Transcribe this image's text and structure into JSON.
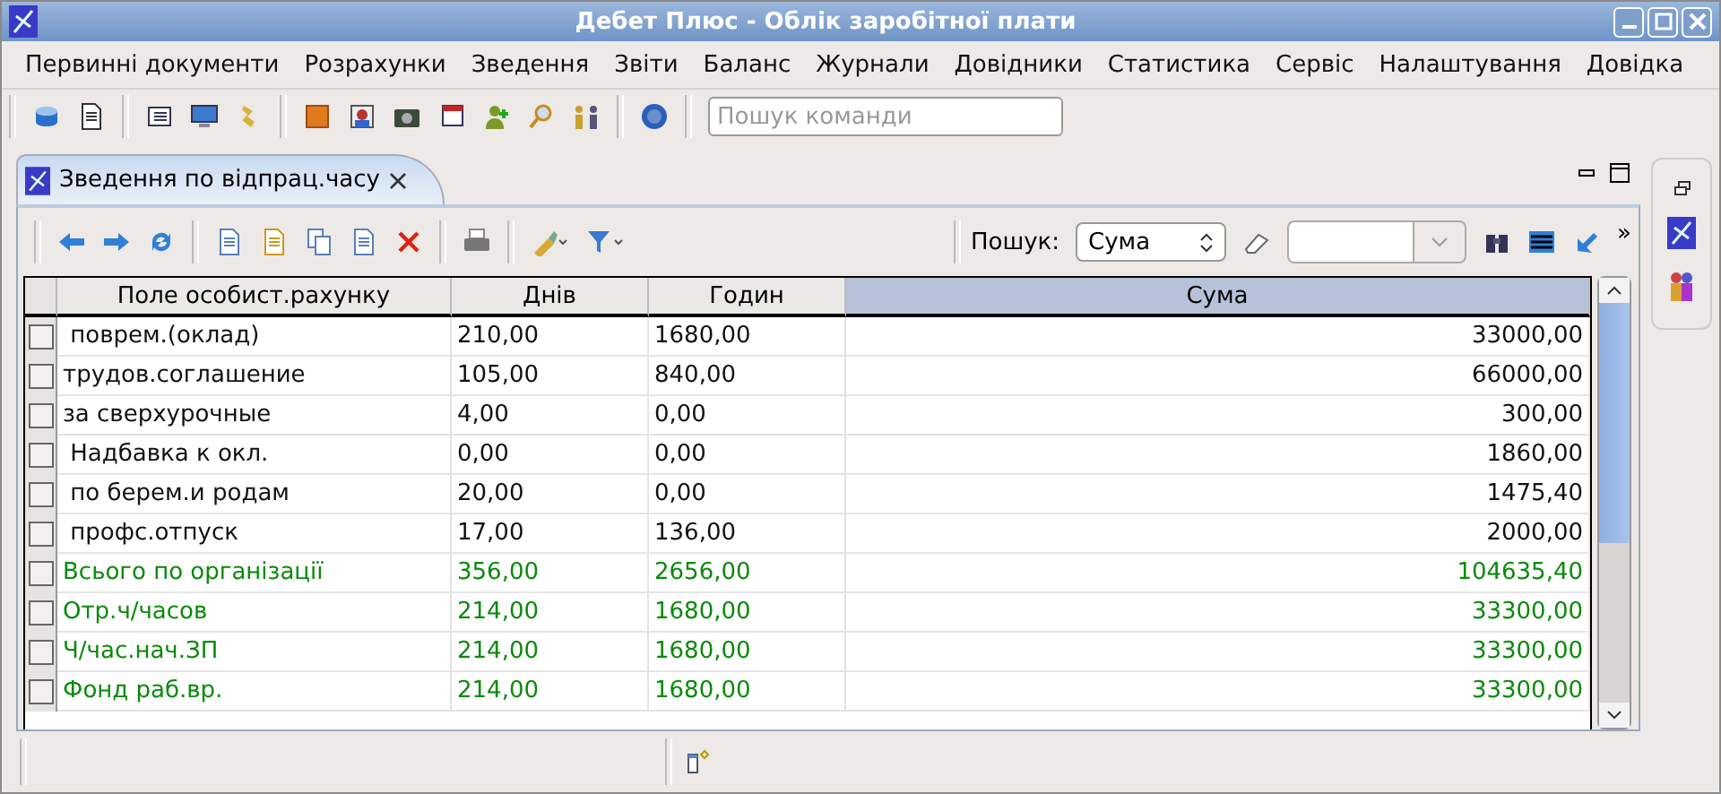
{
  "window": {
    "title": "Дебет Плюс - Облік заробітної плати"
  },
  "menu": [
    "Первинні документи",
    "Розрахунки",
    "Зведення",
    "Звіти",
    "Баланс",
    "Журнали",
    "Довідники",
    "Статистика",
    "Сервіс",
    "Налаштування",
    "Довідка"
  ],
  "command_search": {
    "placeholder": "Пошук команди"
  },
  "editor_tab": {
    "label": "Зведення по відпрац.часу",
    "selected": true
  },
  "search": {
    "label": "Пошук:",
    "field": "Сума",
    "more": "»"
  },
  "table": {
    "columns": [
      {
        "label": "Поле особист.рахунку",
        "selected": false
      },
      {
        "label": "Днів",
        "selected": false
      },
      {
        "label": "Годин",
        "selected": false
      },
      {
        "label": "Сума",
        "selected": true
      }
    ],
    "rows": [
      {
        "kind": "item",
        "checked": false,
        "cells": [
          " поврем.(оклад)",
          "210,00",
          "1680,00",
          "33000,00"
        ]
      },
      {
        "kind": "item",
        "checked": false,
        "cells": [
          "трудов.соглашение",
          "105,00",
          "840,00",
          "66000,00"
        ]
      },
      {
        "kind": "item",
        "checked": false,
        "cells": [
          "за сверхурочные",
          "4,00",
          "0,00",
          "300,00"
        ]
      },
      {
        "kind": "item",
        "checked": false,
        "cells": [
          " Надбавка к окл.",
          "0,00",
          "0,00",
          "1860,00"
        ]
      },
      {
        "kind": "item",
        "checked": false,
        "cells": [
          " по берем.и родам",
          "20,00",
          "0,00",
          "1475,40"
        ]
      },
      {
        "kind": "item",
        "checked": false,
        "cells": [
          " профс.отпуск",
          "17,00",
          "136,00",
          "2000,00"
        ]
      },
      {
        "kind": "total",
        "checked": false,
        "cells": [
          "Всього по організації",
          "356,00",
          "2656,00",
          "104635,40"
        ]
      },
      {
        "kind": "total",
        "checked": false,
        "cells": [
          "Отр.ч/часов",
          "214,00",
          "1680,00",
          "33300,00"
        ]
      },
      {
        "kind": "total",
        "checked": false,
        "cells": [
          "Ч/час.нач.ЗП",
          "214,00",
          "1680,00",
          "33300,00"
        ]
      },
      {
        "kind": "total",
        "checked": false,
        "cells": [
          "Фонд раб.вр.",
          "214,00",
          "1680,00",
          "33300,00"
        ]
      }
    ]
  }
}
